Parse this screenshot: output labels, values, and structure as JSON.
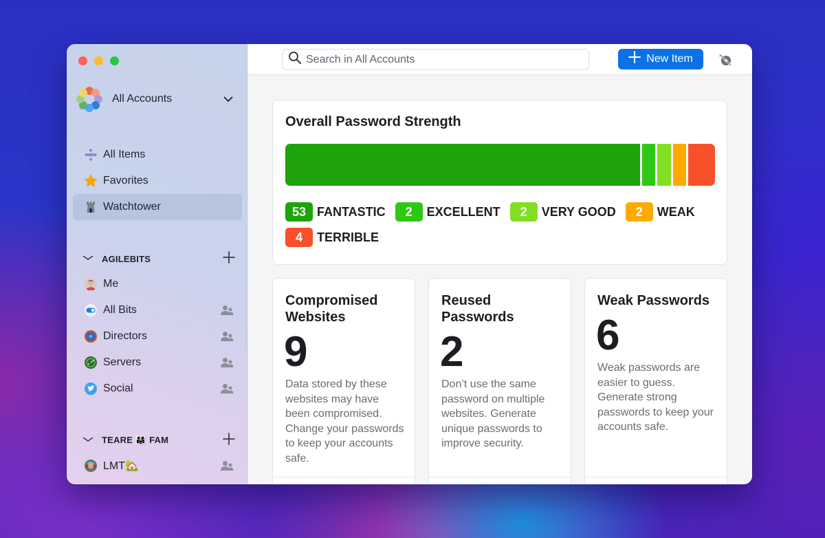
{
  "window": {
    "traffic_lights": [
      "close",
      "minimize",
      "zoom"
    ]
  },
  "sidebar": {
    "account_switcher": {
      "label": "All Accounts",
      "icon": "chevron-down-icon"
    },
    "nav": [
      {
        "label": "All Items",
        "icon": "all-items-icon"
      },
      {
        "label": "Favorites",
        "icon": "star-icon"
      },
      {
        "label": "Watchtower",
        "icon": "watchtower-icon",
        "active": true
      }
    ],
    "sections": [
      {
        "title": "AGILEBITS",
        "vaults": [
          {
            "label": "Me",
            "shared": false
          },
          {
            "label": "All Bits",
            "shared": true
          },
          {
            "label": "Directors",
            "shared": true
          },
          {
            "label": "Servers",
            "shared": true
          },
          {
            "label": "Social",
            "shared": true
          }
        ]
      },
      {
        "title": "TEARE 👨‍👩‍👧 FAM",
        "vaults": [
          {
            "label": "LMT🏡",
            "shared": true
          }
        ]
      }
    ]
  },
  "toolbar": {
    "search_placeholder": "Search in All Accounts",
    "new_item_label": "New Item"
  },
  "strength": {
    "title": "Overall Password Strength",
    "levels": [
      {
        "count": "53",
        "label": "FANTASTIC",
        "value": 53,
        "color": "#1ea40a"
      },
      {
        "count": "2",
        "label": "EXCELLENT",
        "value": 2,
        "color": "#2ec814"
      },
      {
        "count": "2",
        "label": "VERY GOOD",
        "value": 2,
        "color": "#80e021"
      },
      {
        "count": "2",
        "label": "WEAK",
        "value": 2,
        "color": "#ffaa00"
      },
      {
        "count": "4",
        "label": "TERRIBLE",
        "value": 4,
        "color": "#f7502a"
      }
    ]
  },
  "stats": [
    {
      "title": "Compromised Websites",
      "value": "9",
      "description": "Data stored by these websites may have been compromised. Change your passwords to keep your accounts safe."
    },
    {
      "title": "Reused Passwords",
      "value": "2",
      "description": "Don’t use the same password on multiple websites. Generate unique passwords to improve security."
    },
    {
      "title": "Weak Passwords",
      "value": "6",
      "description": "Weak passwords are easier to guess. Generate strong passwords to keep your accounts safe."
    }
  ]
}
